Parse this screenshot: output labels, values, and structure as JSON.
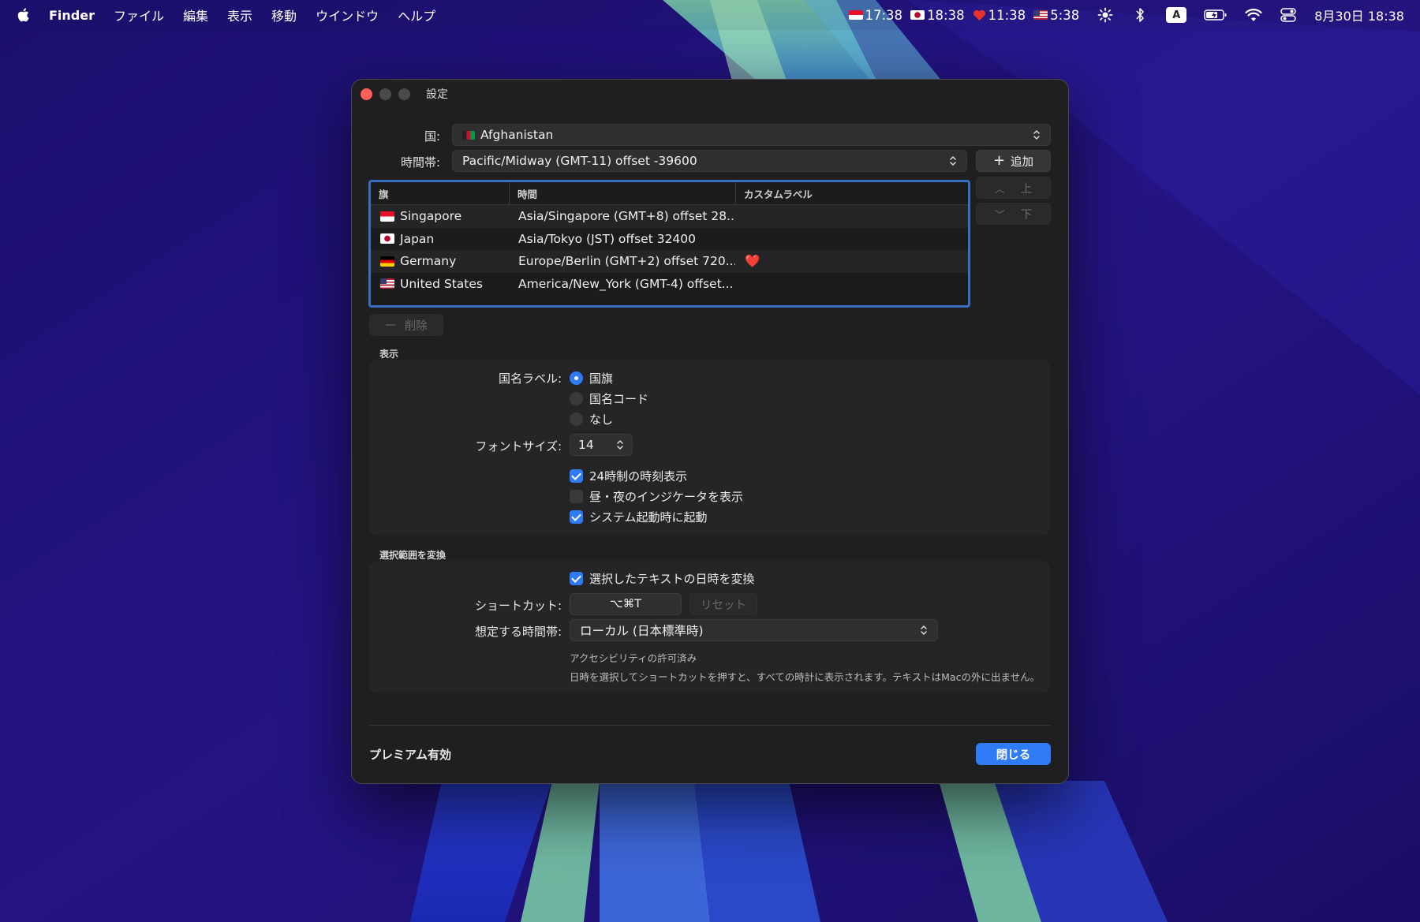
{
  "menubar": {
    "app_name": "Finder",
    "menus": [
      "ファイル",
      "編集",
      "表示",
      "移動",
      "ウインドウ",
      "ヘルプ"
    ],
    "clocks": [
      {
        "flag": "singapore",
        "time": "17:38"
      },
      {
        "flag": "japan",
        "time": "18:38"
      },
      {
        "flag": "heart",
        "time": "11:38"
      },
      {
        "flag": "united-states",
        "time": "5:38"
      }
    ],
    "input_badge": "A",
    "datetime": "8月30日 18:38"
  },
  "window": {
    "title": "設定",
    "country_label": "国:",
    "country_value": "Afghanistan",
    "timezone_label": "時間帯:",
    "timezone_value": "Pacific/Midway (GMT-11) offset -39600",
    "add_button": "追加",
    "up_button": "上",
    "down_button": "下",
    "delete_button": "削除",
    "table": {
      "headers": [
        "旗",
        "時間",
        "カスタムラベル"
      ],
      "rows": [
        {
          "flag": "singapore",
          "country": "Singapore",
          "time": "Asia/Singapore (GMT+8) offset 28...",
          "label": ""
        },
        {
          "flag": "japan",
          "country": "Japan",
          "time": "Asia/Tokyo (JST) offset 32400",
          "label": ""
        },
        {
          "flag": "germany",
          "country": "Germany",
          "time": "Europe/Berlin (GMT+2) offset 720...",
          "label": "❤️"
        },
        {
          "flag": "united-states",
          "country": "United States",
          "time": "America/New_York (GMT-4) offset...",
          "label": ""
        }
      ]
    },
    "display_section": {
      "title": "表示",
      "country_label_label": "国名ラベル:",
      "radio_options": [
        {
          "label": "国旗",
          "selected": true
        },
        {
          "label": "国名コード",
          "selected": false
        },
        {
          "label": "なし",
          "selected": false
        }
      ],
      "font_size_label": "フォントサイズ:",
      "font_size_value": "14",
      "checkboxes": [
        {
          "label": "24時制の時刻表示",
          "checked": true
        },
        {
          "label": "昼・夜のインジケータを表示",
          "checked": false
        },
        {
          "label": "システム起動時に起動",
          "checked": true
        }
      ]
    },
    "convert_section": {
      "title": "選択範囲を変換",
      "convert_checkbox": {
        "label": "選択したテキストの日時を変換",
        "checked": true
      },
      "shortcut_label": "ショートカット:",
      "shortcut_value": "⌥⌘T",
      "reset_button": "リセット",
      "assumed_tz_label": "想定する時間帯:",
      "assumed_tz_value": "ローカル (日本標準時)",
      "note_permission": "アクセシビリティの許可済み",
      "note_description": "日時を選択してショートカットを押すと、すべての時計に表示されます。テキストはMacの外に出ません。"
    },
    "premium_text": "プレミアム有効",
    "close_button": "閉じる"
  },
  "colors": {
    "accent": "#2f7bf5",
    "table_focus_border": "#3a6ec2",
    "window_bg": "#1f1f21"
  }
}
